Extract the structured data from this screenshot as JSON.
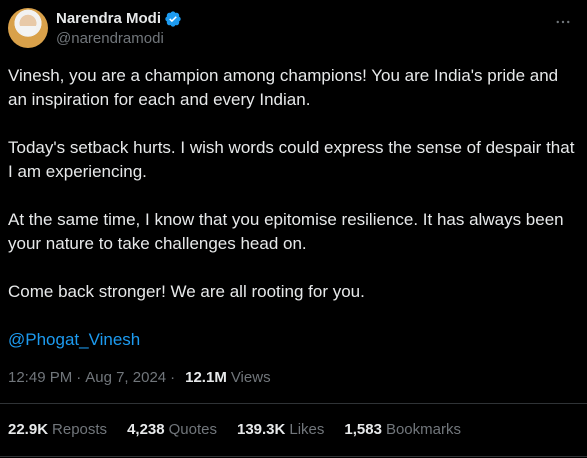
{
  "author": {
    "name": "Narendra Modi",
    "handle": "@narendramodi",
    "verified_icon": "verified-badge-icon",
    "avatar_icon": "profile-avatar"
  },
  "more_icon": "more-options-icon",
  "tweet": {
    "paragraphs": [
      "Vinesh, you are a champion among champions! You are India's pride and an inspiration for each and every Indian.",
      "Today's setback hurts. I wish words could express the sense of despair that I am experiencing.",
      "At the same time, I know that you epitomise resilience. It has always been your nature to take challenges head on.",
      "Come back stronger! We are all rooting for you."
    ],
    "mention": "@Phogat_Vinesh"
  },
  "meta": {
    "time": "12:49 PM",
    "date": "Aug 7, 2024",
    "separator": "·",
    "views_count": "12.1M",
    "views_label": "Views"
  },
  "stats": [
    {
      "num": "22.9K",
      "label": "Reposts"
    },
    {
      "num": "4,238",
      "label": "Quotes"
    },
    {
      "num": "139.3K",
      "label": "Likes"
    },
    {
      "num": "1,583",
      "label": "Bookmarks"
    }
  ],
  "colors": {
    "background": "#000000",
    "text": "#e7e9ea",
    "muted": "#71767b",
    "link": "#1d9bf0",
    "verified": "#1d9bf0",
    "divider": "#2f3336"
  }
}
